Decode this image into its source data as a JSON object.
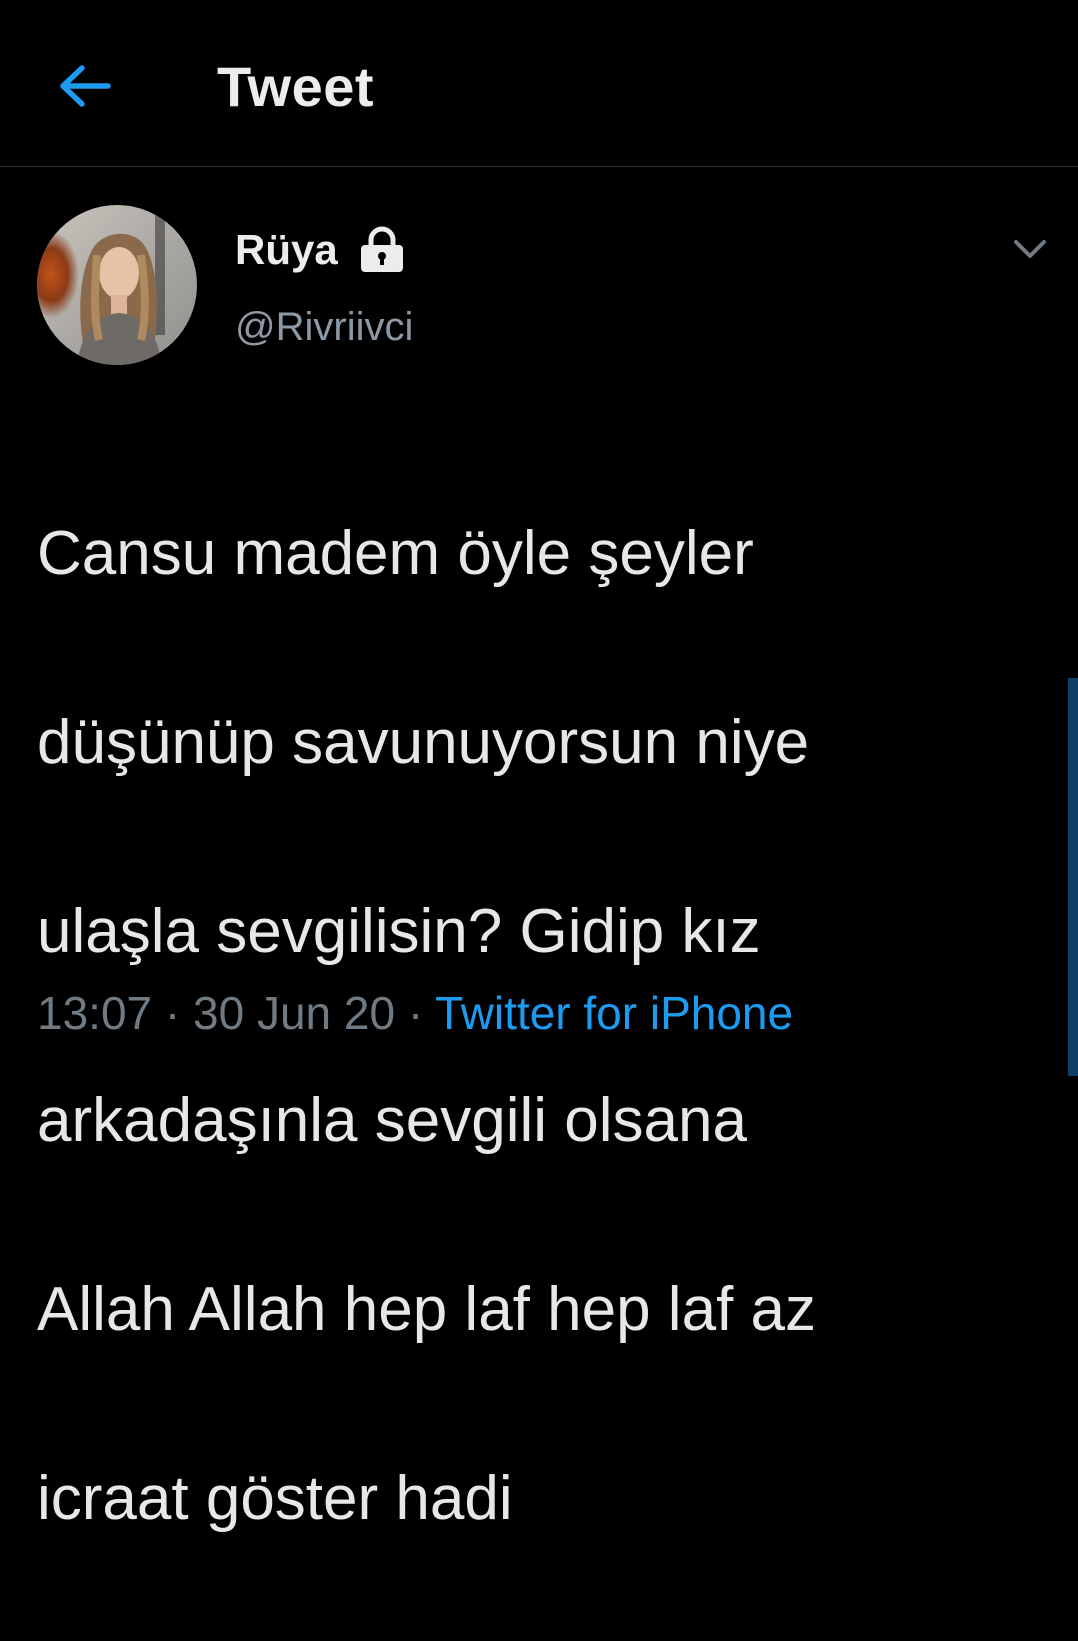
{
  "header": {
    "title": "Tweet",
    "back_icon": "arrow-left-icon",
    "accent_color": "#1d9bf0"
  },
  "tweet": {
    "author": {
      "display_name": "Rüya",
      "handle": "@Rivriivci",
      "protected_icon": "lock-icon",
      "avatar": "profile-photo"
    },
    "more_icon": "chevron-down-icon",
    "text_lines": [
      "Cansu madem öyle şeyler",
      "düşünüp savunuyorsun niye",
      "ulaşla sevgilisin? Gidip kız",
      "arkadaşınla sevgili olsana",
      "Allah Allah hep laf hep laf az",
      "icraat göster hadi"
    ],
    "time": "13:07",
    "separator": "·",
    "date": "30 Jun 20",
    "source": "Twitter for iPhone"
  },
  "colors": {
    "background": "#000000",
    "text": "#e7e7e7",
    "secondary_text": "#6f7a83",
    "link": "#1d9bf0"
  }
}
